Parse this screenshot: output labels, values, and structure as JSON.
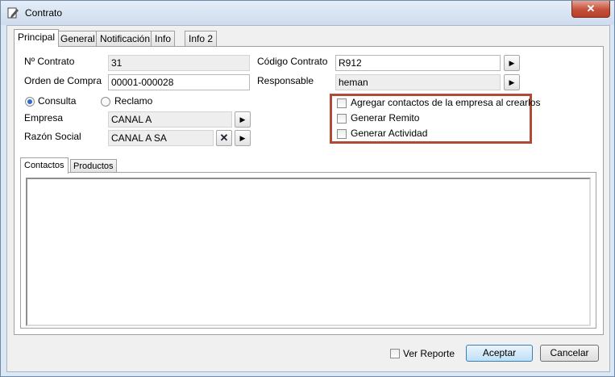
{
  "window": {
    "title": "Contrato",
    "close_glyph": "✕"
  },
  "tabs": [
    "Principal",
    "General",
    "Notificación",
    "Info",
    "Info 2"
  ],
  "form": {
    "nro_contrato": {
      "label": "Nº Contrato",
      "value": "31"
    },
    "orden_compra": {
      "label": "Orden de Compra",
      "value": "00001-000028"
    },
    "codigo_contrato": {
      "label": "Código Contrato",
      "value": "R912"
    },
    "responsable": {
      "label": "Responsable",
      "value": "heman"
    },
    "tipo": {
      "consulta": "Consulta",
      "reclamo": "Reclamo",
      "selected": "Consulta"
    },
    "empresa": {
      "label": "Empresa",
      "value": "CANAL A"
    },
    "razon_social": {
      "label": "Razón Social",
      "value": "CANAL A SA"
    }
  },
  "options": {
    "agregar_contactos": "Agregar contactos de la empresa al crearlos",
    "generar_remito": "Generar Remito",
    "generar_actividad": "Generar Actividad"
  },
  "subtabs": [
    "Contactos",
    "Productos"
  ],
  "footer": {
    "ver_reporte": "Ver Reporte",
    "aceptar": "Aceptar",
    "cancelar": "Cancelar"
  },
  "icons": {
    "arrow": "▶",
    "clear": "✕"
  },
  "colors": {
    "highlight": "#b04a34",
    "titlebar": "#dce7f4"
  }
}
